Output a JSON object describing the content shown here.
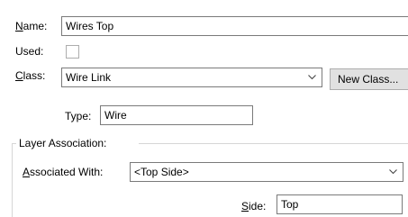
{
  "form": {
    "name_label_u": "N",
    "name_label_rest": "ame:",
    "name_value": "Wires Top",
    "used_label": "Used:",
    "used_checked": false,
    "class_label_u": "C",
    "class_label_rest": "lass:",
    "class_value": "Wire Link",
    "new_class_button": "New Class...",
    "type_label": "Type:",
    "type_value": "Wire"
  },
  "layer_group": {
    "title": "Layer Association:",
    "associated_label_u": "A",
    "associated_label_rest": "ssociated With:",
    "associated_value": "<Top Side>",
    "side_label_u": "S",
    "side_label_rest": "ide:",
    "side_value": "Top"
  },
  "icons": {
    "dropdown": "chevron-down-icon"
  }
}
